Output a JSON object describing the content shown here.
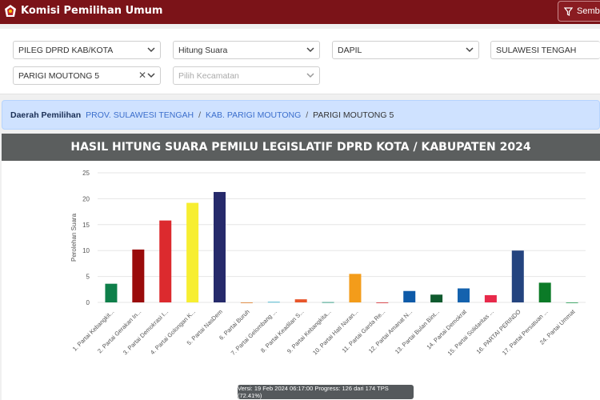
{
  "app": {
    "title": "Komisi Pemilihan Umum",
    "toggle_label": "Sembu"
  },
  "filters": {
    "election": "PILEG DPRD KAB/KOTA",
    "mode": "Hitung Suara",
    "dapil": "DAPIL",
    "province": "SULAWESI TENGAH",
    "region": "PARIGI MOUTONG 5",
    "kecamatan_placeholder": "Pilih Kecamatan"
  },
  "breadcrumb": {
    "label": "Daerah Pemilihan",
    "items": [
      "PROV. SULAWESI TENGAH",
      "KAB. PARIGI MOUTONG"
    ],
    "separator": "/",
    "current": "PARIGI MOUTONG 5"
  },
  "chart": {
    "header": "HASIL HITUNG SUARA PEMILU LEGISLATIF DPRD KOTA / KABUPATEN 2024",
    "tooltip": "Versi: 19 Feb 2024 06:17:00 Progress: 126 dari 174 TPS (72.41%)"
  },
  "chart_data": {
    "type": "bar",
    "ylabel": "Perolehan Suara",
    "ylim": [
      0,
      25
    ],
    "yticks": [
      0,
      5,
      10,
      15,
      20,
      25
    ],
    "categories": [
      "1. Partai Kebangkit...",
      "2. Partai Gerakan In...",
      "3. Partai Demokrasi I...",
      "4. Partai Golongan K...",
      "5. Partai NasDem",
      "6. Partai Buruh",
      "7. Partai Gelombang ...",
      "8. Partai Keadilan S...",
      "9. Partai Kebangkita...",
      "10. Partai Hati Nuran...",
      "11. Partai Garda Re...",
      "12. Partai Amanat N...",
      "13. Partai Bulan Bint...",
      "14. Partai Demokrat",
      "15. Partai Solidaritas ...",
      "16. PARTAI PERINDO",
      "17. Partai Persatuan ...",
      "24. Partai Ummat"
    ],
    "values": [
      3.6,
      10.2,
      15.8,
      19.2,
      21.3,
      0,
      0.1,
      0.6,
      0.05,
      5.5,
      0,
      2.2,
      1.5,
      2.7,
      1.4,
      10.0,
      3.8,
      0
    ],
    "colors": [
      "#0e7f4a",
      "#9a0b0b",
      "#dc2a2e",
      "#f7ee31",
      "#262a6b",
      "#e07a22",
      "#29a9c7",
      "#e8562b",
      "#0e8a6e",
      "#f39c1a",
      "#d6262c",
      "#0e5aa8",
      "#0f5a2e",
      "#1462ae",
      "#e8294a",
      "#24447f",
      "#0b7a27",
      "#1f9a4f"
    ]
  }
}
